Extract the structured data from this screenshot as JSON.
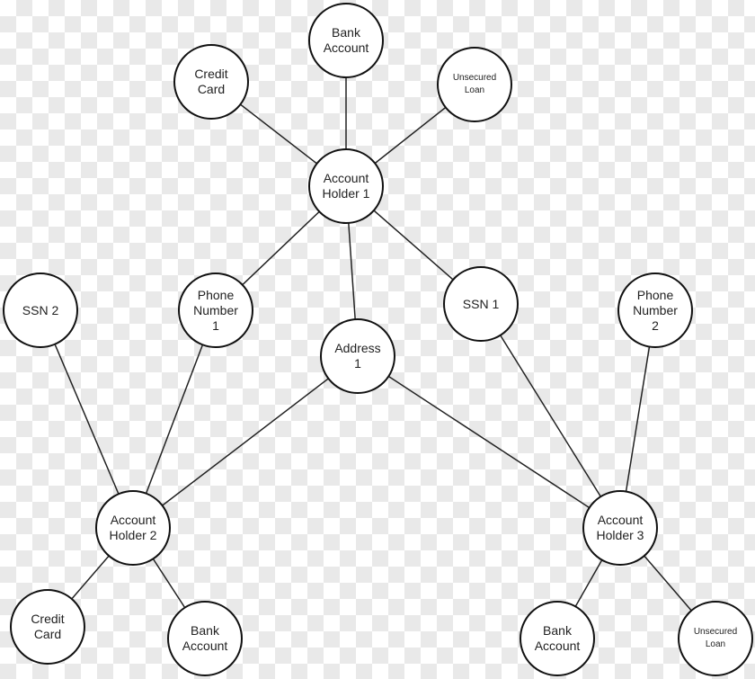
{
  "nodes": [
    {
      "id": "bank-top",
      "label": "Bank\nAccount"
    },
    {
      "id": "cc-top",
      "label": "Credit\nCard"
    },
    {
      "id": "loan-top",
      "label": "Unsecured\nLoan",
      "small": true
    },
    {
      "id": "ah1",
      "label": "Account\nHolder 1"
    },
    {
      "id": "phone1",
      "label": "Phone\nNumber\n1"
    },
    {
      "id": "ssn2",
      "label": "SSN 2"
    },
    {
      "id": "addr1",
      "label": "Address\n1"
    },
    {
      "id": "ssn1",
      "label": "SSN 1"
    },
    {
      "id": "phone2",
      "label": "Phone\nNumber\n2"
    },
    {
      "id": "ah2",
      "label": "Account\nHolder 2"
    },
    {
      "id": "ah3",
      "label": "Account\nHolder 3"
    },
    {
      "id": "cc-bl",
      "label": "Credit\nCard"
    },
    {
      "id": "bank-bl",
      "label": "Bank\nAccount"
    },
    {
      "id": "bank-br",
      "label": "Bank\nAccount"
    },
    {
      "id": "loan-br",
      "label": "Unsecured\nLoan",
      "small": true
    }
  ],
  "edges": [
    [
      "ah1",
      "bank-top"
    ],
    [
      "ah1",
      "cc-top"
    ],
    [
      "ah1",
      "loan-top"
    ],
    [
      "ah1",
      "phone1"
    ],
    [
      "ah1",
      "addr1"
    ],
    [
      "ah1",
      "ssn1"
    ],
    [
      "ah2",
      "ssn2"
    ],
    [
      "ah2",
      "phone1"
    ],
    [
      "ah2",
      "addr1"
    ],
    [
      "ah2",
      "cc-bl"
    ],
    [
      "ah2",
      "bank-bl"
    ],
    [
      "ah3",
      "addr1"
    ],
    [
      "ah3",
      "ssn1"
    ],
    [
      "ah3",
      "phone2"
    ],
    [
      "ah3",
      "bank-br"
    ],
    [
      "ah3",
      "loan-br"
    ]
  ]
}
